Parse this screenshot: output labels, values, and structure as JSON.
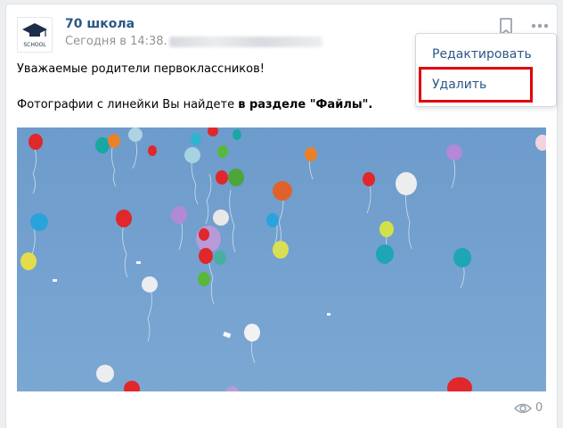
{
  "post": {
    "author": "70 школа",
    "date": "Сегодня в 14:38",
    "date_suffix": ".",
    "avatar_text": "SCHOOL",
    "line1": "Уважаемые родители первоклассников!",
    "line2_plain": "Фотографии с линейки Вы найдете ",
    "line2_bold": "в разделе \"Файлы\".",
    "views": "0"
  },
  "menu": {
    "edit_label": "Редактировать",
    "delete_label": "Удалить"
  },
  "icons": {
    "bookmark": "bookmark-icon",
    "more": "more-icon",
    "views": "eye-icon"
  },
  "colors": {
    "link": "#2a5885",
    "highlight": "#e1000b",
    "sky": "#6f9fcf"
  }
}
